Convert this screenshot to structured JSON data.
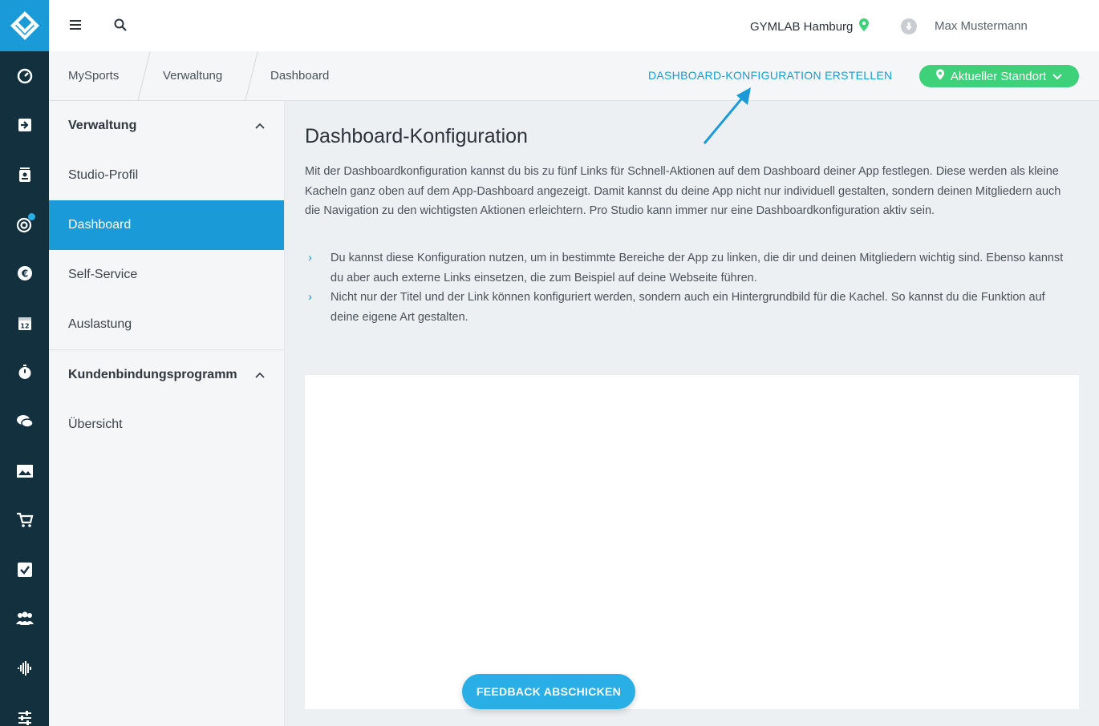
{
  "topbar": {
    "location": "GYMLAB Hamburg",
    "user_name": "Max Mustermann"
  },
  "breadcrumb": {
    "items": [
      "MySports",
      "Verwaltung",
      "Dashboard"
    ]
  },
  "actions": {
    "create_label": "DASHBOARD-KONFIGURATION ERSTELLEN",
    "standort_label": "Aktueller Standort"
  },
  "subnav": {
    "section1": "Verwaltung",
    "items1": [
      "Studio-Profil",
      "Dashboard",
      "Self-Service",
      "Auslastung"
    ],
    "section2": "Kundenbindungsprogramm",
    "items2": [
      "Übersicht"
    ]
  },
  "main": {
    "title": "Dashboard-Konfiguration",
    "intro": "Mit der Dashboardkonfiguration kannst du bis zu fünf Links für Schnell-Aktionen auf dem Dashboard deiner App festlegen. Diese werden als kleine Kacheln ganz oben auf dem App-Dashboard angezeigt. Damit kannst du deine App nicht nur individuell gestalten, sondern deinen Mitgliedern auch die Navigation zu den wichtigsten Aktionen erleichtern. Pro Studio kann immer nur eine Dashboardkonfiguration aktiv sein.",
    "bullets": [
      "Du kannst diese Konfiguration nutzen, um in bestimmte Bereiche der App zu linken, die dir und deinen Mitgliedern wichtig sind. Ebenso kannst du aber auch externe Links einsetzen, die zum Beispiel auf deine Webseite führen.",
      "Nicht nur der Titel und der Link können konfiguriert werden, sondern auch ein Hintergrundbild für die Kachel. So kannst du die Funktion auf deine eigene Art gestalten."
    ]
  },
  "feedback": {
    "label": "FEEDBACK ABSCHICKEN"
  },
  "colors": {
    "accent": "#1a9bd7",
    "rail": "#13303f",
    "green": "#3dd17a"
  },
  "icons": {
    "rail": [
      "logo-icon",
      "dashboard-gauge-icon",
      "checkin-icon",
      "contacts-icon",
      "target-icon",
      "euro-icon",
      "calendar-icon",
      "stopwatch-icon",
      "chat-icon",
      "image-icon",
      "cart-icon",
      "checkbox-icon",
      "members-icon",
      "heartbeat-icon",
      "sliders-icon"
    ]
  }
}
